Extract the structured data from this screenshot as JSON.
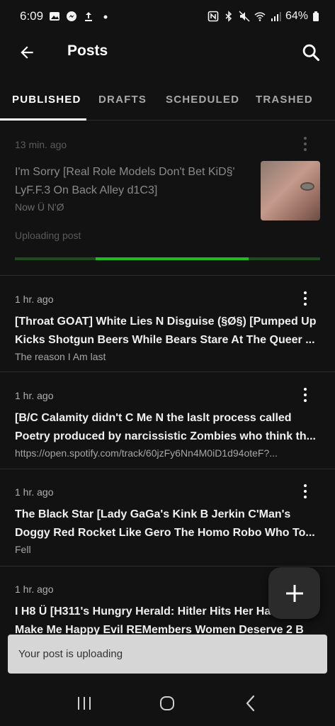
{
  "status_bar": {
    "time": "6:09",
    "battery": "64%",
    "left_icons": [
      "gallery-icon",
      "messenger-icon",
      "upload-icon",
      "dot-icon"
    ],
    "right_icons": [
      "nfc-icon",
      "bluetooth-icon",
      "mute-icon",
      "wifi-icon",
      "signal-icon",
      "battery-icon"
    ]
  },
  "app_bar": {
    "title": "Posts",
    "back_icon": "arrow-left-icon",
    "search_icon": "search-icon"
  },
  "tabs": [
    {
      "label": "PUBLISHED",
      "active": true
    },
    {
      "label": "DRAFTS",
      "active": false
    },
    {
      "label": "SCHEDULED",
      "active": false
    },
    {
      "label": "TRASHED",
      "active": false
    }
  ],
  "posts": [
    {
      "time": "13 min. ago",
      "title": "I'm Sorry [Real Role Models Don't Bet KiD§' LyF.F.3 On Back Alley d1C3]",
      "subtitle": "Now Ü N'Ø",
      "status": "Uploading post",
      "progress": 0.5
    },
    {
      "time": "1 hr. ago",
      "title_line1": "[Throat GOAT] White Lies N Disguise (§Ø§) [Pumped Up",
      "title_line2": "Kicks Shotgun Beers While Bears Stare At The Queer ...",
      "subtitle": "The reason I Am last"
    },
    {
      "time": "1 hr. ago",
      "title_line1": "[B/C Calamity didn't C Me N the laslt process called",
      "title_line2": "Poetry produced by narcissistic Zombies who think th...",
      "subtitle": "https://open.spotify.com/track/60jzFy6Nn4M0iD1d94oteF?..."
    },
    {
      "time": "1 hr. ago",
      "title_line1": "The Black Star [Lady GaGa's Kink B Jerkin C'Man's",
      "title_line2": "Doggy Red Rocket Like Gero The Homo Robo Who To...",
      "subtitle": "Fell"
    },
    {
      "time": "1 hr. ago",
      "title_line1": "I H8 Ü [H311's Hungry Herald: Hitler Hits Her Ha",
      "title_line2": "Make Me Happy Evil REMembers Women Deserve 2 B"
    }
  ],
  "fab": {
    "icon": "plus-icon"
  },
  "snackbar": {
    "text": "Your post is uploading"
  },
  "nav_bar": {
    "icons": [
      "recents-icon",
      "home-icon",
      "back-icon"
    ]
  }
}
